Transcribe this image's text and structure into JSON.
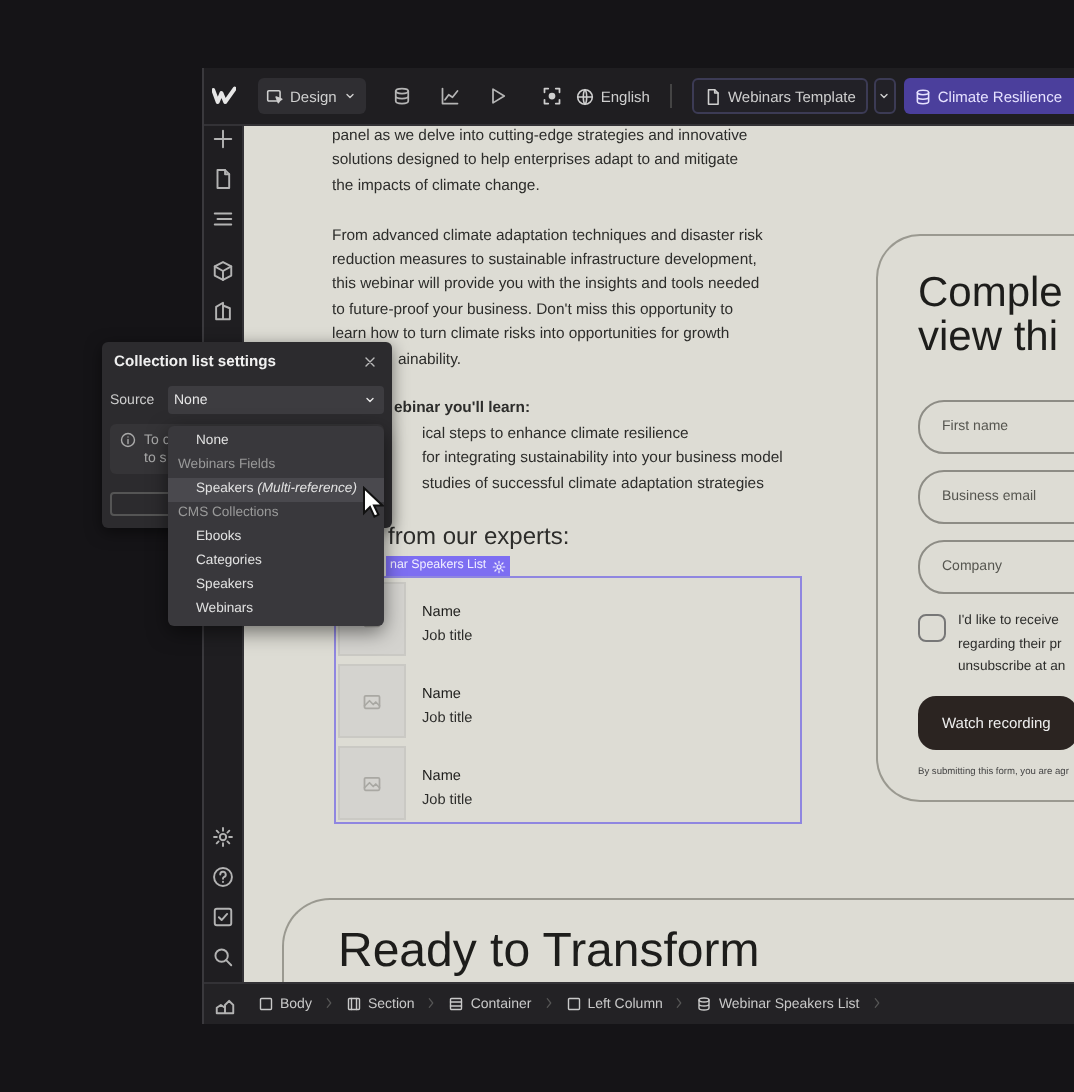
{
  "topbar": {
    "mode_label": "Design",
    "locale": "English",
    "page": "Webinars Template",
    "collection": "Climate Resilience"
  },
  "article": {
    "intro_lines": [
      "panel as we delve into cutting-edge strategies and innovative",
      "solutions designed to help enterprises adapt to and mitigate",
      "the impacts of climate change."
    ],
    "body_lines": [
      "From advanced climate adaptation techniques and disaster risk",
      "reduction measures to sustainable infrastructure development,",
      "this webinar will provide you with the insights and tools needed",
      "to future-proof your business. Don't miss this opportunity to",
      "learn how to turn climate risks into opportunities for growth"
    ],
    "body_tail": "ainability.",
    "learn_heading": "ebinar you'll learn:",
    "learn_items": [
      "ical steps to enhance climate resilience",
      "for integrating sustainability into your business model",
      "studies of successful climate adaptation strategies"
    ],
    "experts_heading": "from our experts:"
  },
  "speakers_list": {
    "badge": "nar Speakers List",
    "items": [
      {
        "name": "Name",
        "job_title": "Job title"
      },
      {
        "name": "Name",
        "job_title": "Job title"
      },
      {
        "name": "Name",
        "job_title": "Job title"
      }
    ]
  },
  "form_card": {
    "heading_lines": [
      "Comple",
      "view thi"
    ],
    "fields": [
      {
        "placeholder": "First name"
      },
      {
        "placeholder": "Business email"
      },
      {
        "placeholder": "Company"
      }
    ],
    "consent": {
      "checked": false,
      "lines": [
        "I'd like to receive",
        "regarding their pr",
        "unsubscribe at an"
      ]
    },
    "button": "Watch recording",
    "disclaimer": "By submitting this form, you are agr"
  },
  "cta_card": {
    "heading": "Ready to Transform"
  },
  "breadcrumbs": [
    {
      "label": "Body",
      "kind": "box"
    },
    {
      "label": "Section",
      "kind": "section"
    },
    {
      "label": "Container",
      "kind": "container"
    },
    {
      "label": "Left Column",
      "kind": "box"
    },
    {
      "label": "Webinar Speakers List",
      "kind": "collection"
    }
  ],
  "settings_panel": {
    "title": "Collection list settings",
    "source_label": "Source",
    "source_value": "None",
    "info_lines": [
      "To c",
      "to s"
    ]
  },
  "source_menu": [
    {
      "kind": "option",
      "label": "None",
      "highlighted": false
    },
    {
      "kind": "header",
      "label": "Webinars Fields"
    },
    {
      "kind": "option",
      "label": "Speakers *(Multi-reference)*",
      "highlighted": true
    },
    {
      "kind": "header",
      "label": "CMS Collections"
    },
    {
      "kind": "option",
      "label": "Ebooks",
      "highlighted": false
    },
    {
      "kind": "option",
      "label": "Categories",
      "highlighted": false
    },
    {
      "kind": "option",
      "label": "Speakers",
      "highlighted": false
    },
    {
      "kind": "option",
      "label": "Webinars",
      "highlighted": false
    }
  ]
}
